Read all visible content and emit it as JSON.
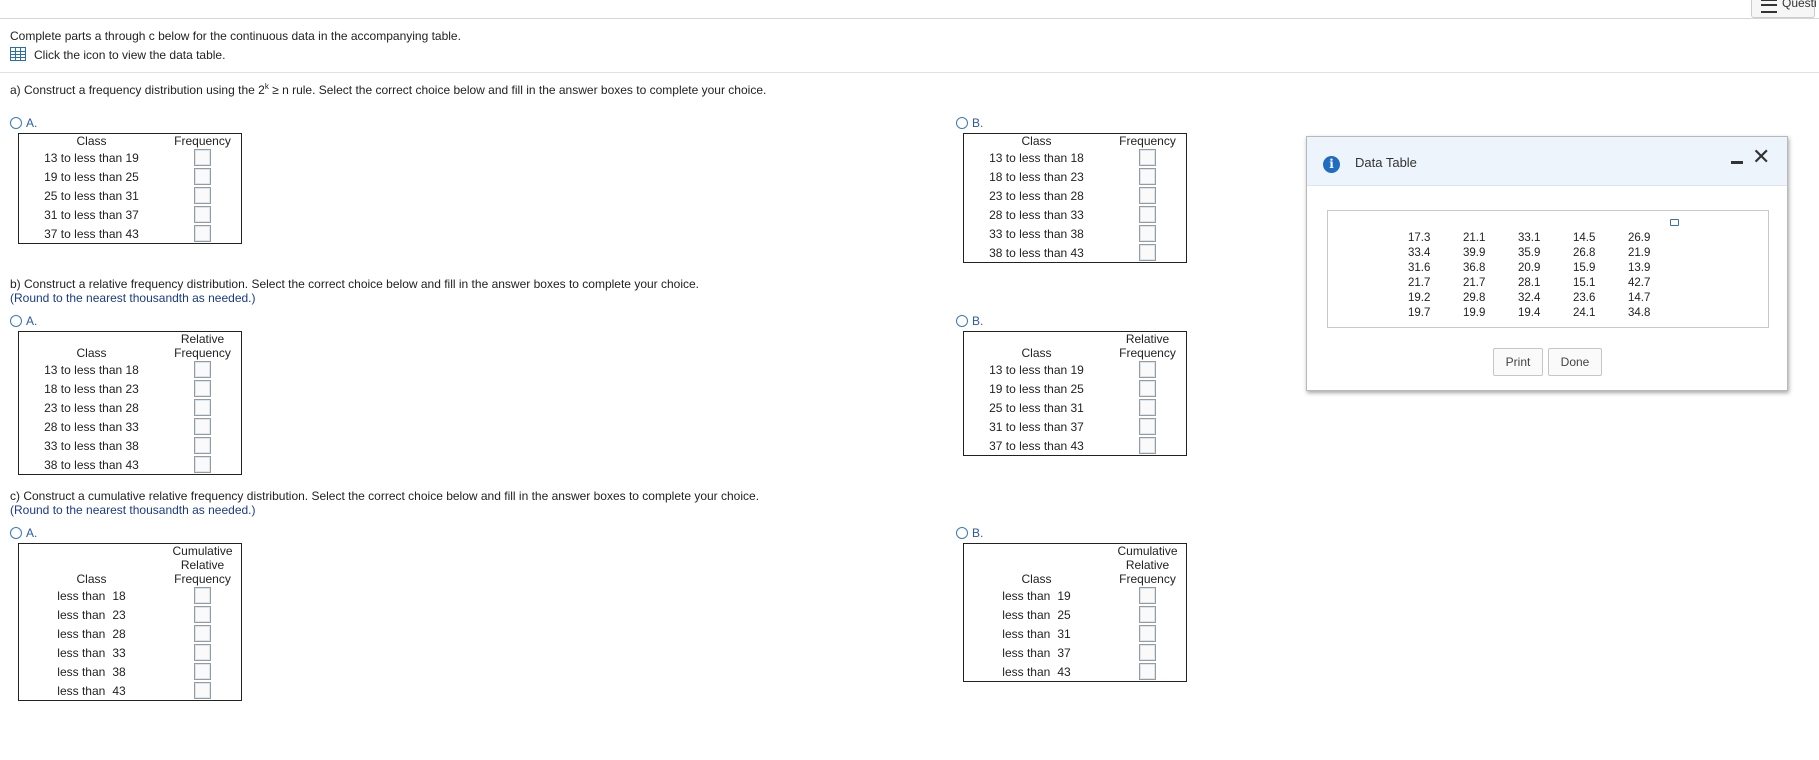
{
  "header": {
    "questions_label": "Questi"
  },
  "instructions": "Complete parts a through c below for the continuous data in the accompanying table.",
  "table_link": "Click the icon to view the data table.",
  "part_a": {
    "question_pre": "a) Construct a frequency distribution using the 2",
    "question_sup": "k",
    "question_post": " ≥ n rule. Select the correct choice below and fill in the answer boxes to complete your choice.",
    "option_a": {
      "label": "A.",
      "class_header": "Class",
      "freq_header": "Frequency",
      "classes": [
        "13 to less than 19",
        "19 to less than 25",
        "25 to less than 31",
        "31 to less than 37",
        "37 to less than 43"
      ]
    },
    "option_b": {
      "label": "B.",
      "class_header": "Class",
      "freq_header": "Frequency",
      "classes": [
        "13 to less than 18",
        "18 to less than 23",
        "23 to less than 28",
        "28 to less than 33",
        "33 to less than 38",
        "38 to less than 43"
      ]
    }
  },
  "part_b": {
    "question": "b) Construct a relative frequency distribution. Select the correct choice below and fill in the answer boxes to complete your choice.",
    "hint": "(Round to the nearest thousandth as needed.)",
    "option_a": {
      "label": "A.",
      "class_header": "Class",
      "freq_header_1": "Relative",
      "freq_header_2": "Frequency",
      "classes": [
        "13 to less than 18",
        "18 to less than 23",
        "23 to less than 28",
        "28 to less than 33",
        "33 to less than 38",
        "38 to less than 43"
      ]
    },
    "option_b": {
      "label": "B.",
      "class_header": "Class",
      "freq_header_1": "Relative",
      "freq_header_2": "Frequency",
      "classes": [
        "13 to less than 19",
        "19 to less than 25",
        "25 to less than 31",
        "31 to less than 37",
        "37 to less than 43"
      ]
    }
  },
  "part_c": {
    "question": "c) Construct a cumulative relative frequency distribution. Select the correct choice below and fill in the answer boxes to complete your choice.",
    "hint": "(Round to the nearest thousandth as needed.)",
    "option_a": {
      "label": "A.",
      "class_header": "Class",
      "freq_header_1": "Cumulative",
      "freq_header_2": "Relative",
      "freq_header_3": "Frequency",
      "less_than": "less than",
      "bounds": [
        "18",
        "23",
        "28",
        "33",
        "38",
        "43"
      ]
    },
    "option_b": {
      "label": "B.",
      "class_header": "Class",
      "freq_header_1": "Cumulative",
      "freq_header_2": "Relative",
      "freq_header_3": "Frequency",
      "less_than": "less than",
      "bounds": [
        "19",
        "25",
        "31",
        "37",
        "43"
      ]
    }
  },
  "data_table_modal": {
    "title": "Data Table",
    "rows": [
      [
        "17.3",
        "21.1",
        "33.1",
        "14.5",
        "26.9"
      ],
      [
        "33.4",
        "39.9",
        "35.9",
        "26.8",
        "21.9"
      ],
      [
        "31.6",
        "36.8",
        "20.9",
        "15.9",
        "13.9"
      ],
      [
        "21.7",
        "21.7",
        "28.1",
        "15.1",
        "42.7"
      ],
      [
        "19.2",
        "29.8",
        "32.4",
        "23.6",
        "14.7"
      ],
      [
        "19.7",
        "19.9",
        "19.4",
        "24.1",
        "34.8"
      ]
    ],
    "print_label": "Print",
    "done_label": "Done"
  }
}
